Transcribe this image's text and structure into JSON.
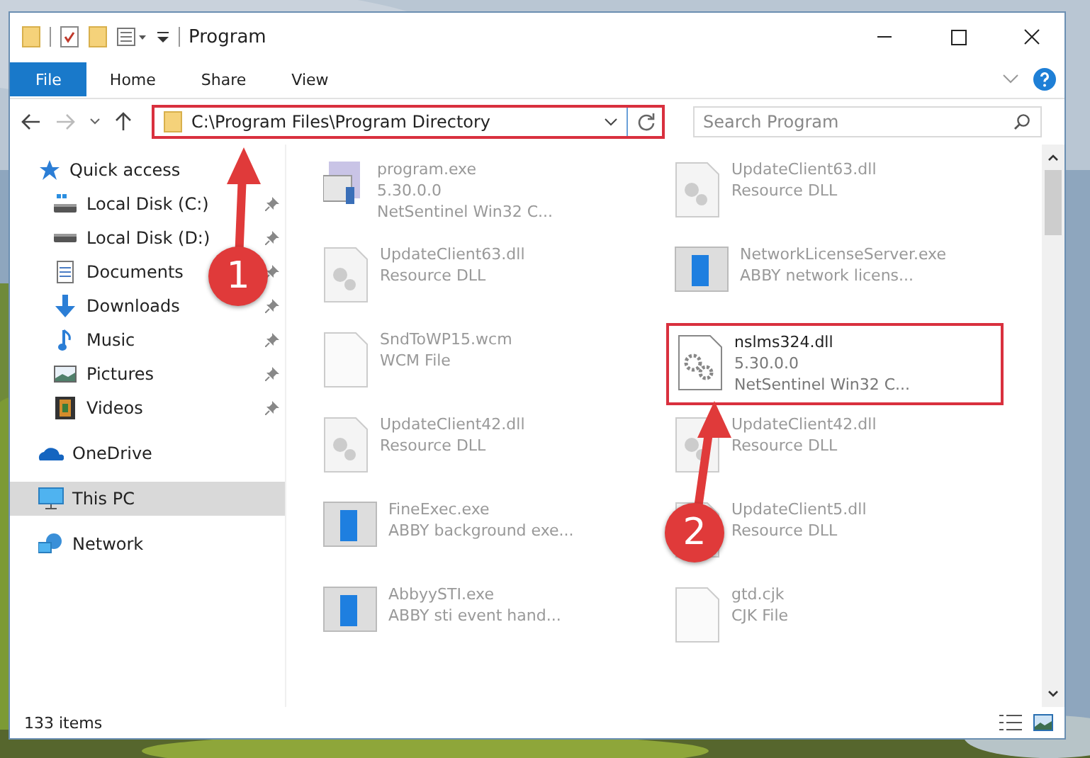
{
  "window": {
    "title": "Program"
  },
  "ribbon_tabs": [
    {
      "label": "File",
      "selected": true
    },
    {
      "label": "Home",
      "selected": false
    },
    {
      "label": "Share",
      "selected": false
    },
    {
      "label": "View",
      "selected": false
    }
  ],
  "address_bar": {
    "path": "C:\\Program Files\\Program Directory",
    "highlighted": true
  },
  "search": {
    "placeholder": "Search Program"
  },
  "sidebar": {
    "items": [
      {
        "label": "Quick access",
        "kind": "star",
        "selected": false,
        "children": [
          {
            "label": "Local Disk (C:)",
            "kind": "drive-c",
            "pinned": true,
            "selected": false
          },
          {
            "label": "Local Disk (D:)",
            "kind": "drive",
            "pinned": true,
            "selected": false
          },
          {
            "label": "Documents",
            "kind": "documents",
            "pinned": true,
            "selected": false
          },
          {
            "label": "Downloads",
            "kind": "downloads",
            "pinned": true,
            "selected": false
          },
          {
            "label": "Music",
            "kind": "music",
            "pinned": true,
            "selected": false
          },
          {
            "label": "Pictures",
            "kind": "pictures",
            "pinned": true,
            "selected": false
          },
          {
            "label": "Videos",
            "kind": "videos",
            "pinned": true,
            "selected": false
          }
        ]
      },
      {
        "label": "OneDrive",
        "kind": "cloud",
        "selected": false
      },
      {
        "label": "This PC",
        "kind": "pc",
        "selected": true
      },
      {
        "label": "Network",
        "kind": "network",
        "selected": false
      }
    ]
  },
  "files": [
    {
      "name": "program.exe",
      "lines": [
        "5.30.0.0",
        "NetSentinel Win32 C..."
      ],
      "kind": "program",
      "highlighted": false
    },
    {
      "name": "UpdateClient63.dll",
      "lines": [
        "Resource DLL"
      ],
      "kind": "dll",
      "highlighted": false
    },
    {
      "name": "UpdateClient63.dll",
      "lines": [
        "Resource DLL"
      ],
      "kind": "dll",
      "highlighted": false
    },
    {
      "name": "NetworkLicenseServer.exe",
      "lines": [
        "ABBY network licens..."
      ],
      "kind": "exe",
      "highlighted": false
    },
    {
      "name": "SndToWP15.wcm",
      "lines": [
        "WCM File"
      ],
      "kind": "file",
      "highlighted": false
    },
    {
      "name": "nslms324.dll",
      "lines": [
        "5.30.0.0",
        "NetSentinel Win32 C..."
      ],
      "kind": "gear",
      "highlighted": true
    },
    {
      "name": "UpdateClient42.dll",
      "lines": [
        "Resource DLL"
      ],
      "kind": "dll",
      "highlighted": false
    },
    {
      "name": "UpdateClient42.dll",
      "lines": [
        "Resource DLL"
      ],
      "kind": "dll",
      "highlighted": false
    },
    {
      "name": "FineExec.exe",
      "lines": [
        "ABBY background exe..."
      ],
      "kind": "exe",
      "highlighted": false
    },
    {
      "name": "UpdateClient5.dll",
      "lines": [
        "Resource DLL"
      ],
      "kind": "dll",
      "highlighted": false
    },
    {
      "name": "AbbyySTI.exe",
      "lines": [
        "ABBY sti event hand..."
      ],
      "kind": "exe",
      "highlighted": false
    },
    {
      "name": "gtd.cjk",
      "lines": [
        "CJK File"
      ],
      "kind": "file",
      "highlighted": false
    }
  ],
  "status_bar": {
    "count": "133 items"
  },
  "annotations": [
    {
      "label": "1"
    },
    {
      "label": "2"
    }
  ]
}
